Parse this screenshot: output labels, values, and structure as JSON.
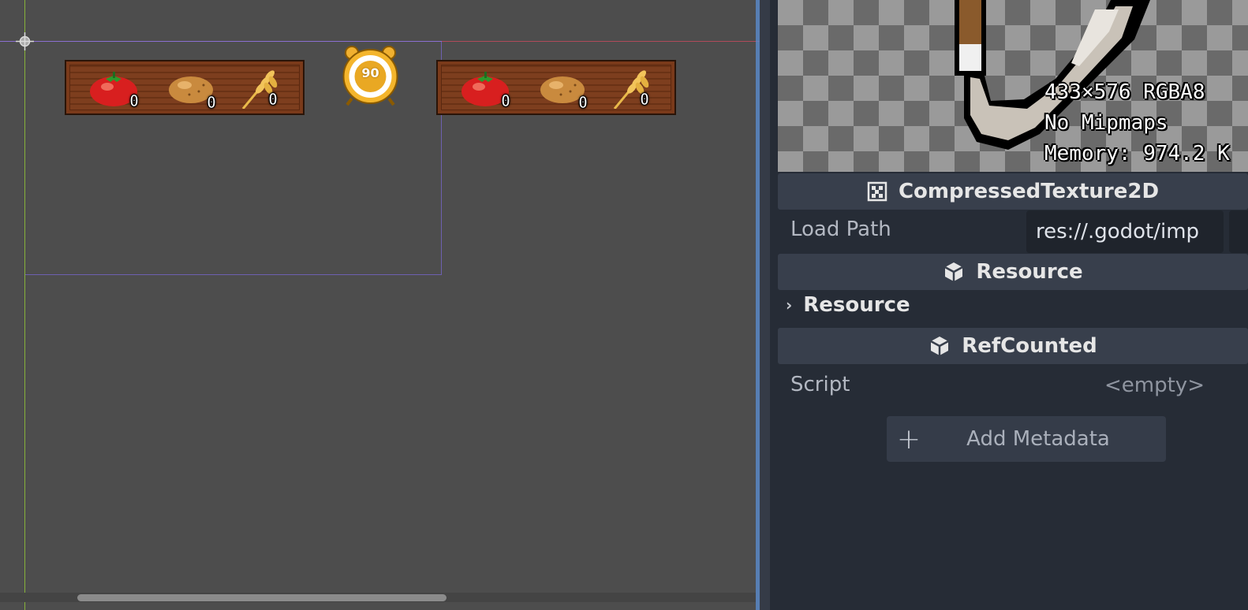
{
  "viewport": {
    "hud_left": {
      "items": [
        {
          "icon": "tomato-icon",
          "count": "0"
        },
        {
          "icon": "potato-icon",
          "count": "0"
        },
        {
          "icon": "wheat-icon",
          "count": "0"
        }
      ]
    },
    "timer": {
      "icon": "alarm-clock-icon",
      "value": "90"
    },
    "hud_right": {
      "items": [
        {
          "icon": "tomato-icon",
          "count": "0"
        },
        {
          "icon": "potato-icon",
          "count": "0"
        },
        {
          "icon": "wheat-icon",
          "count": "0"
        }
      ]
    }
  },
  "inspector": {
    "preview": {
      "dimensions": "433×576 RGBA8",
      "mipmaps": "No Mipmaps",
      "memory": "Memory: 974.2 K"
    },
    "class_header": "CompressedTexture2D",
    "load_path": {
      "label": "Load Path",
      "value": "res://.godot/imp"
    },
    "resource_header": "Resource",
    "resource_group": "Resource",
    "refcounted_header": "RefCounted",
    "script": {
      "label": "Script",
      "value": "<empty>"
    },
    "add_metadata_label": "Add Metadata"
  },
  "colors": {
    "accent": "#5b8fd6",
    "panel_bg": "#262c36",
    "header_bg": "#383f4c",
    "hud_wood": "#7a3a1a",
    "timer_gold": "#f0b030"
  }
}
